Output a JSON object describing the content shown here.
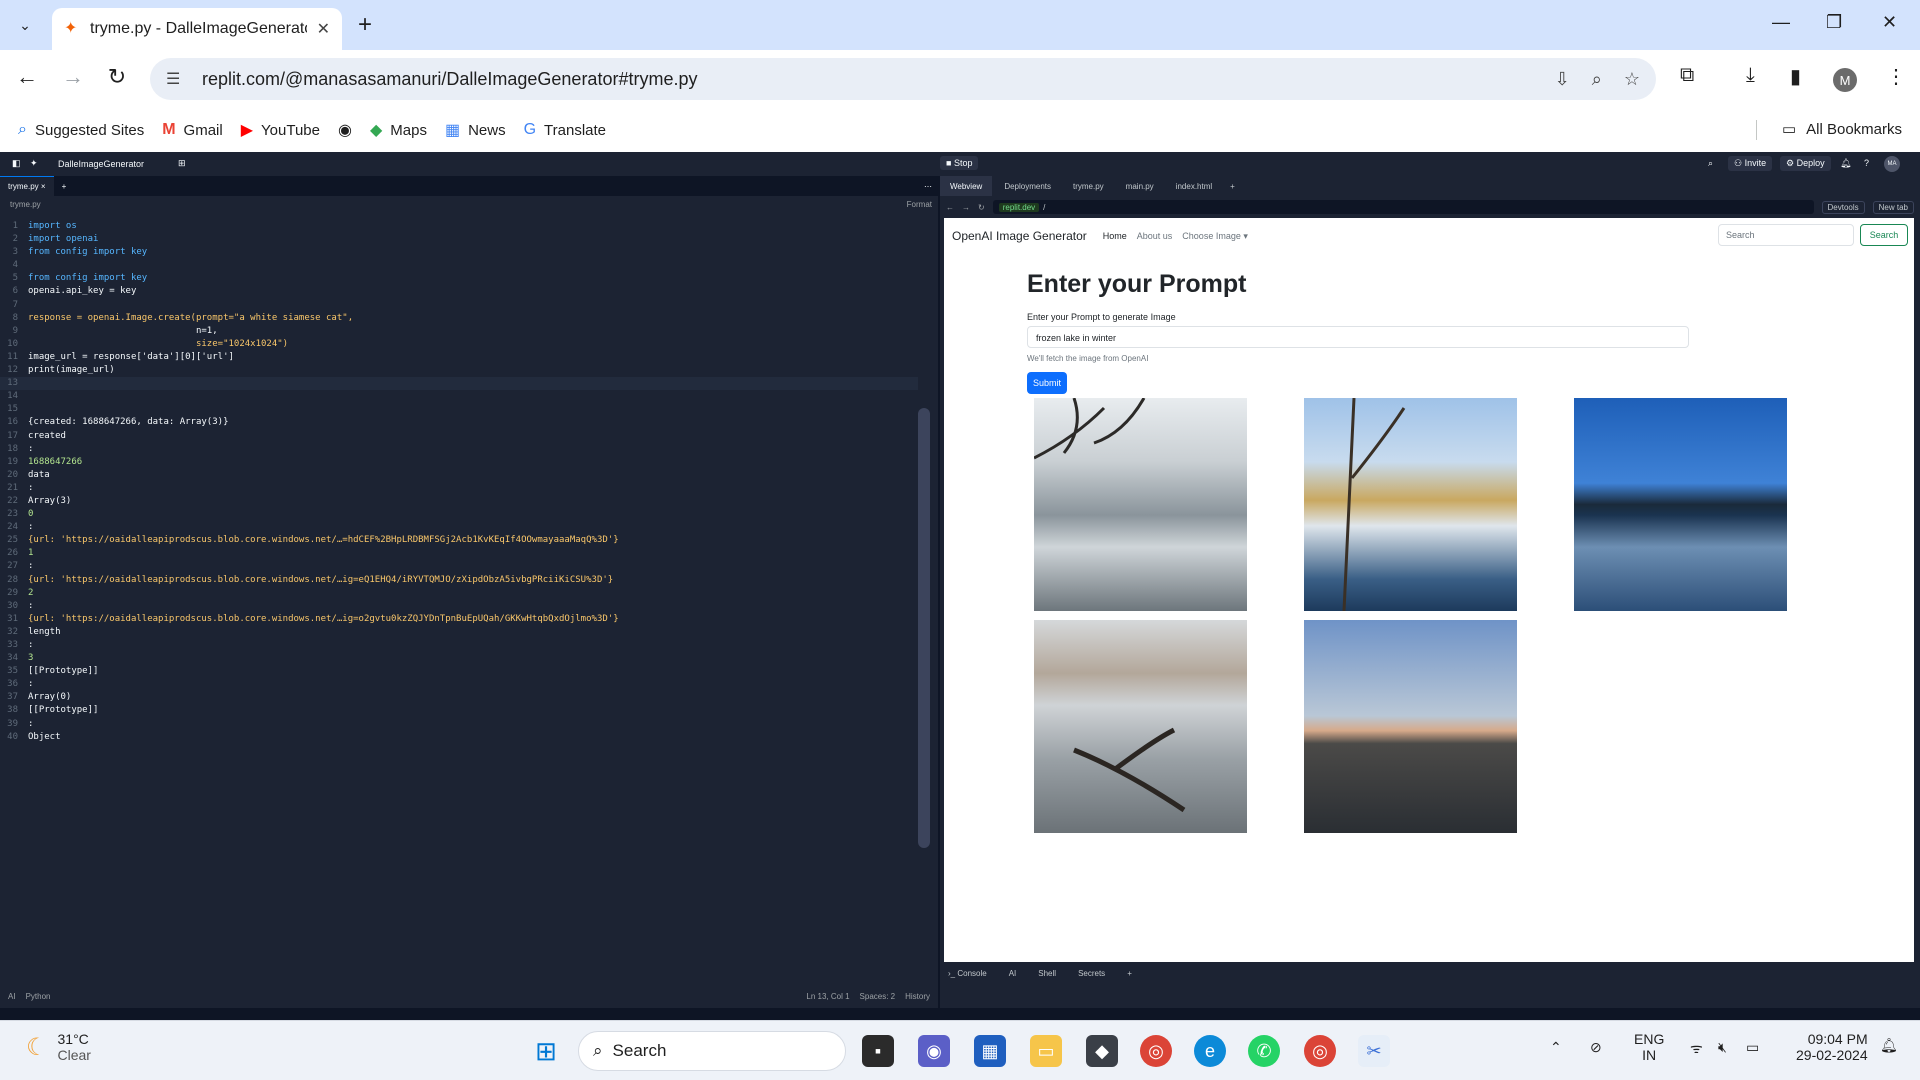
{
  "browser": {
    "tab_title": "tryme.py - DalleImageGenerato",
    "url": "replit.com/@manasasamanuri/DalleImageGenerator#tryme.py",
    "bookmarks": [
      "Suggested Sites",
      "Gmail",
      "YouTube",
      "Maps",
      "News",
      "Translate"
    ],
    "all_bookmarks": "All Bookmarks",
    "avatar": "M"
  },
  "replit": {
    "repl_name": "DalleImageGenerator",
    "stop_label": "Stop",
    "invite_label": "Invite",
    "deploy_label": "Deploy",
    "avatar": "MA",
    "editor_tab": "tryme.py",
    "breadcrumb": "tryme.py",
    "format_label": "Format",
    "status": {
      "ai": "AI",
      "language": "Python",
      "position": "Ln 13, Col 1",
      "spaces": "Spaces: 2",
      "history": "History"
    },
    "pane_tabs": [
      "Webview",
      "Deployments",
      "tryme.py",
      "main.py",
      "index.html"
    ],
    "preview_chip": "replit.dev",
    "preview_path": "/",
    "devtools": "Devtools",
    "newtab": "New tab",
    "bottom_tabs": [
      "Console",
      "AI",
      "Shell",
      "Secrets"
    ]
  },
  "code_lines": [
    "import os",
    "import openai",
    "from config import key",
    "",
    "from config import key",
    "openai.api_key = key",
    "",
    "response = openai.Image.create(prompt=\"a white siamese cat\",",
    "                               n=1,",
    "                               size=\"1024x1024\")",
    "image_url = response['data'][0]['url']",
    "print(image_url)",
    "",
    "",
    "",
    "{created: 1688647266, data: Array(3)}",
    "created",
    ":",
    "1688647266",
    "data",
    ":",
    "Array(3)",
    "0",
    ":",
    "{url: 'https://oaidalleapiprodscus.blob.core.windows.net/…=hdCEF%2BHpLRDBMFSGj2Acb1KvKEqIf4OOwmayaaaMaqQ%3D'}",
    "1",
    ":",
    "{url: 'https://oaidalleapiprodscus.blob.core.windows.net/…ig=eQ1EHQ4/iRYVTQMJO/zXipdObzA5ivbgPRciiKiCSU%3D'}",
    "2",
    ":",
    "{url: 'https://oaidalleapiprodscus.blob.core.windows.net/…ig=o2gvtu0kzZQJYDnTpnBuEpUQah/GKKwHtqbQxdOjlmo%3D'}",
    "length",
    ":",
    "3",
    "[[Prototype]]",
    ":",
    "Array(0)",
    "[[Prototype]]",
    ":",
    "Object"
  ],
  "webapp": {
    "brand": "OpenAI Image Generator",
    "nav": [
      "Home",
      "About us",
      "Choose Image"
    ],
    "search_placeholder": "Search",
    "search_button": "Search",
    "heading": "Enter your Prompt",
    "label": "Enter your Prompt to generate Image",
    "input_value": "frozen lake in winter",
    "help": "We'll fetch the image from OpenAI",
    "submit": "Submit"
  },
  "taskbar": {
    "temperature": "31°C",
    "condition": "Clear",
    "search": "Search",
    "lang1": "ENG",
    "lang2": "IN",
    "time": "09:04 PM",
    "date": "29-02-2024"
  }
}
